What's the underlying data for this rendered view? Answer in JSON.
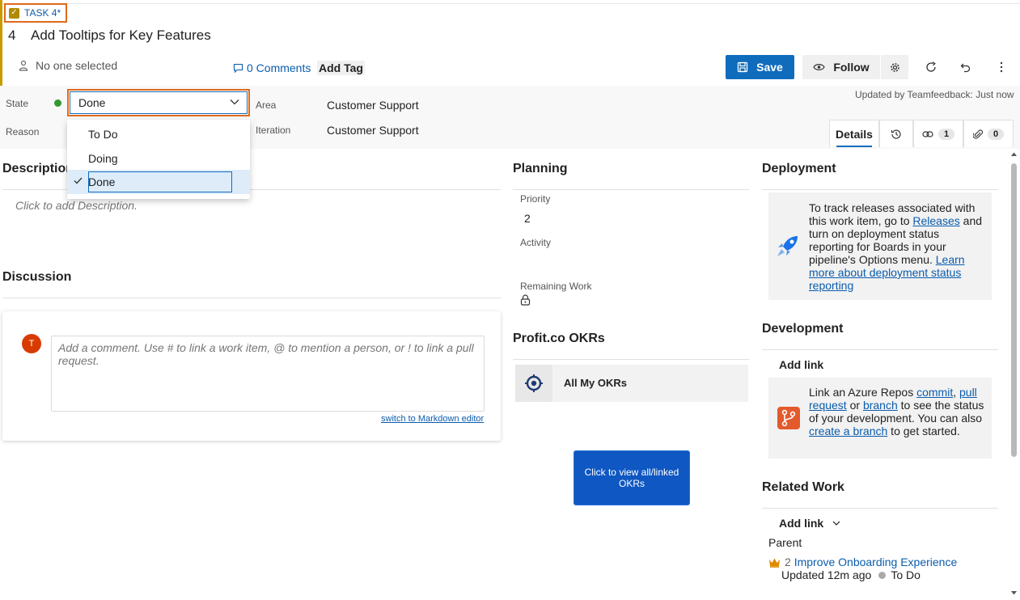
{
  "header": {
    "task_badge": "TASK 4*",
    "id": "4",
    "title": "Add Tooltips for Key Features",
    "assignee": "No one selected",
    "comments": "0 Comments",
    "add_tag": "Add Tag",
    "save": "Save",
    "follow": "Follow"
  },
  "fields": {
    "state_label": "State",
    "state_value": "Done",
    "reason_label": "Reason",
    "area_label": "Area",
    "area_value": "Customer Support",
    "iteration_label": "Iteration",
    "iteration_value": "Customer Support",
    "updated_by": "Updated by Teamfeedback: Just now",
    "state_color": "#339933"
  },
  "state_dropdown": {
    "options": [
      "To Do",
      "Doing",
      "Done"
    ],
    "selected": "Done"
  },
  "tabs": {
    "details": "Details",
    "links_count": "1",
    "attachments_count": "0"
  },
  "description": {
    "title": "Description",
    "placeholder": "Click to add Description."
  },
  "discussion": {
    "title": "Discussion",
    "avatar_initial": "T",
    "comment_placeholder": "Add a comment. Use # to link a work item, @ to mention a person, or ! to link a pull request.",
    "markdown_switch": "switch to Markdown editor"
  },
  "planning": {
    "title": "Planning",
    "priority_label": "Priority",
    "priority_value": "2",
    "activity_label": "Activity",
    "remaining_label": "Remaining Work"
  },
  "okrs": {
    "title": "Profit.co OKRs",
    "all_my_okrs": "All My OKRs",
    "view_button": "Click to view all/linked OKRs"
  },
  "deployment": {
    "title": "Deployment",
    "text_1": "To track releases associated with this work item, go to ",
    "releases_link": "Releases",
    "text_2": " and turn on deployment status reporting for Boards in your pipeline's Options menu. ",
    "learn_link": "Learn more about deployment status reporting"
  },
  "development": {
    "title": "Development",
    "add_link": "Add link",
    "text_1": "Link an Azure Repos ",
    "commit_link": "commit",
    "sep_1": ", ",
    "pr_link": "pull request",
    "sep_2": " or ",
    "branch_link": "branch",
    "text_2": " to see the status of your development. You can also ",
    "create_branch_link": "create a branch",
    "text_3": " to get started."
  },
  "related_work": {
    "title": "Related Work",
    "add_link": "Add link",
    "parent_label": "Parent",
    "parent_id": "2",
    "parent_title": "Improve Onboarding Experience",
    "parent_updated": "Updated 12m ago",
    "parent_state": "To Do"
  }
}
